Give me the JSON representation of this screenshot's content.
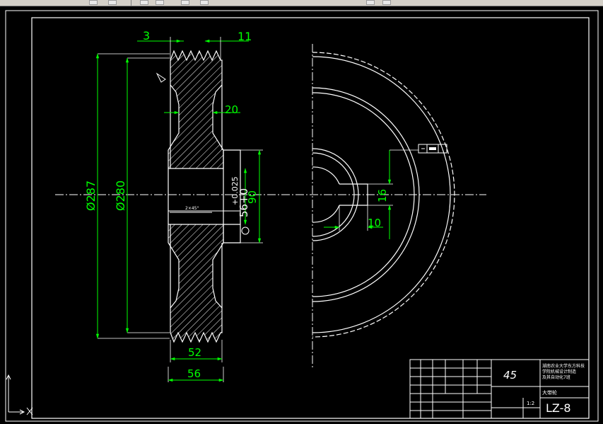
{
  "dimensions": {
    "groove_pitch": "3",
    "groove_width": "11",
    "web_thickness": "20",
    "outer_diameter": "Ø287",
    "pitch_diameter": "Ø280",
    "hub_diameter": "90",
    "bore_tolerance": "+0.025",
    "bore_nominal": "56+0",
    "rim_width": "52",
    "hub_width": "56",
    "key_depth": "16",
    "key_width": "10",
    "chamfer": "2×45°"
  },
  "title_block": {
    "material": "45",
    "drawing_number": "LZ-8",
    "school_line1": "湖南农业大学东方科技",
    "school_line2": "学院机械设计制造",
    "school_line3": "及其自动化7班",
    "part_name": "大带轮",
    "sheet": "1:2"
  },
  "colors": {
    "background": "#000000",
    "geometry": "#ffffff",
    "dimension": "#00ff00",
    "toolbar": "#d4d0c8"
  },
  "ucs_icon": "ucs-axis-icon"
}
